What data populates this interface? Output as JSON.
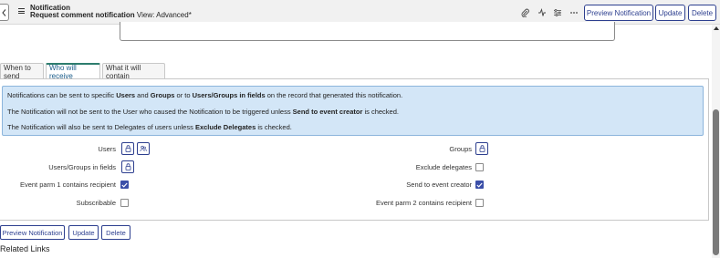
{
  "header": {
    "title": "Notification",
    "record_name": "Request comment notification",
    "view_label": "View: Advanced*",
    "buttons": {
      "preview": "Preview Notification",
      "update": "Update",
      "delete": "Delete"
    },
    "icons": [
      "back-icon",
      "menu-icon",
      "paperclip-icon",
      "activity-icon",
      "settings-sliders-icon",
      "more-icon"
    ]
  },
  "tabs": [
    {
      "label": "When to send",
      "active": false
    },
    {
      "label": "Who will receive",
      "active": true
    },
    {
      "label": "What it will contain",
      "active": false
    }
  ],
  "info": {
    "line1_a": "Notifications can be sent to specific ",
    "line1_b": "Users",
    "line1_c": " and ",
    "line1_d": "Groups",
    "line1_e": " or to ",
    "line1_f": "Users/Groups in fields",
    "line1_g": " on the record that generated this notification.",
    "line2_a": "The Notification will not be sent to the User who caused the Notification to be triggered unless ",
    "line2_b": "Send to event creator",
    "line2_c": " is checked.",
    "line3_a": "The Notification will also be sent to Delegates of users unless ",
    "line3_b": "Exclude Delegates",
    "line3_c": " is checked."
  },
  "fields": {
    "users": "Users",
    "groups": "Groups",
    "users_groups_in_fields": "Users/Groups in fields",
    "exclude_delegates": {
      "label": "Exclude delegates",
      "checked": false
    },
    "event_parm1": {
      "label": "Event parm 1 contains recipient",
      "checked": true
    },
    "send_to_event_creator": {
      "label": "Send to event creator",
      "checked": true
    },
    "subscribable": {
      "label": "Subscribable",
      "checked": false
    },
    "event_parm2": {
      "label": "Event parm 2 contains recipient",
      "checked": false
    }
  },
  "bottom": {
    "preview": "Preview Notification",
    "update": "Update",
    "delete": "Delete"
  },
  "related_links": "Related Links",
  "colors": {
    "accent": "#2d3f8f",
    "info_bg": "#d3e6f7",
    "checkbox_checked": "#3b4fa8",
    "tab_active_border": "#2e7d6e"
  }
}
